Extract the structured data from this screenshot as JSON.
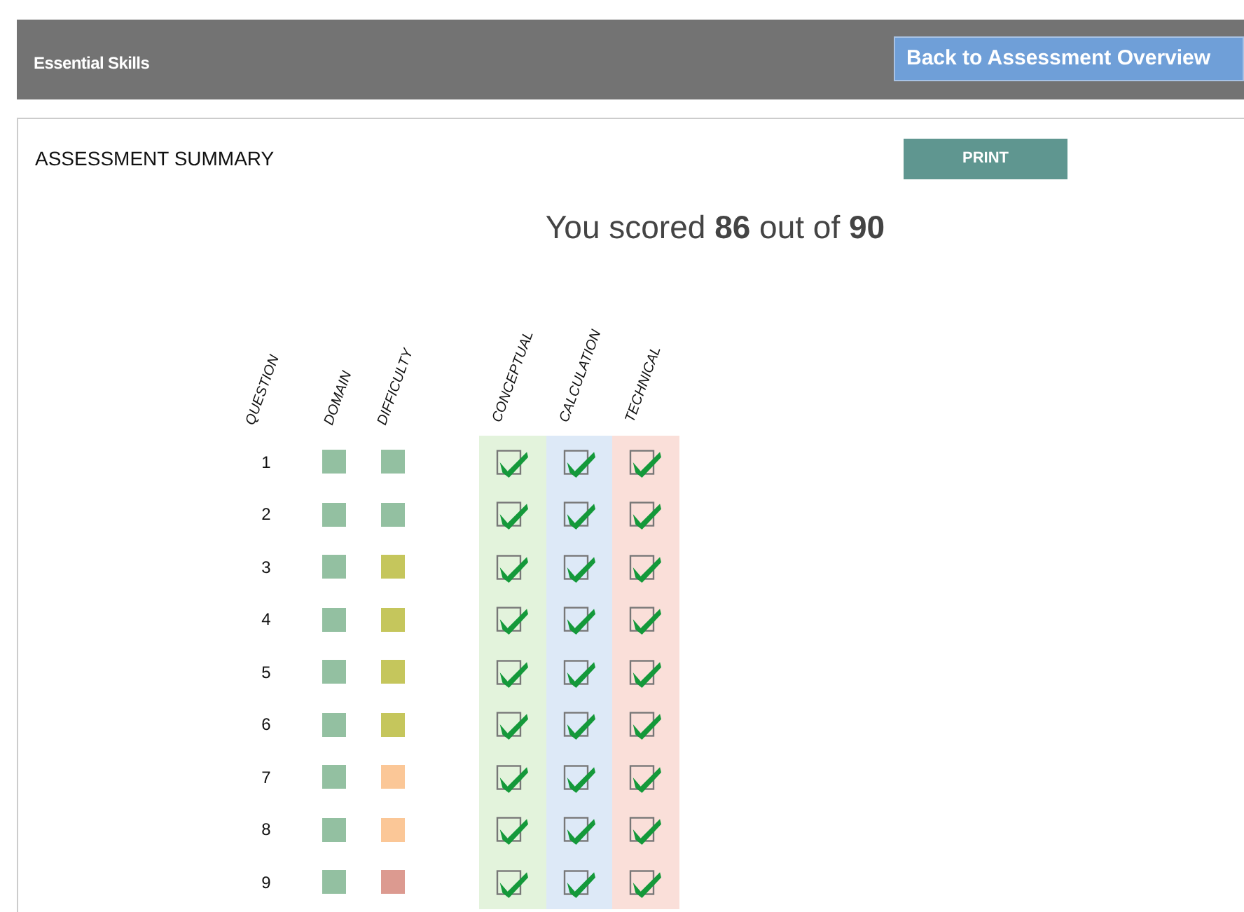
{
  "header": {
    "title": "Essential Skills",
    "back_button": "Back to Assessment Overview"
  },
  "summary": {
    "title": "ASSESSMENT SUMMARY",
    "print_button": "PRINT",
    "score": "You scored **86** out of **90**"
  },
  "table": {
    "columns": [
      {
        "label": "QUESTION"
      },
      {
        "label": "DOMAIN"
      },
      {
        "label": "DIFFICULTY"
      }
    ],
    "score_columns": [
      {
        "label": "CONCEPTUAL",
        "color": "#e3f3dc"
      },
      {
        "label": "CALCULATION",
        "color": "#dde9f7"
      },
      {
        "label": "TECHNICAL",
        "color": "#fadfd9"
      }
    ],
    "rows": [
      {
        "question": "1",
        "domain": {
          "color": "#93c0a1"
        },
        "difficulty": {
          "color": "#93c0a1"
        },
        "checks": [
          true,
          true,
          true
        ]
      },
      {
        "question": "2",
        "domain": {
          "color": "#93c0a1"
        },
        "difficulty": {
          "color": "#93c0a1"
        },
        "checks": [
          true,
          true,
          true
        ]
      },
      {
        "question": "3",
        "domain": {
          "color": "#93c0a1"
        },
        "difficulty": {
          "color": "#c5c65c"
        },
        "checks": [
          true,
          true,
          true
        ]
      },
      {
        "question": "4",
        "domain": {
          "color": "#93c0a1"
        },
        "difficulty": {
          "color": "#c5c65c"
        },
        "checks": [
          true,
          true,
          true
        ]
      },
      {
        "question": "5",
        "domain": {
          "color": "#93c0a1"
        },
        "difficulty": {
          "color": "#c5c65c"
        },
        "checks": [
          true,
          true,
          true
        ]
      },
      {
        "question": "6",
        "domain": {
          "color": "#93c0a1"
        },
        "difficulty": {
          "color": "#c5c65c"
        },
        "checks": [
          true,
          true,
          true
        ]
      },
      {
        "question": "7",
        "domain": {
          "color": "#93c0a1"
        },
        "difficulty": {
          "color": "#fbc797"
        },
        "checks": [
          true,
          true,
          true
        ]
      },
      {
        "question": "8",
        "domain": {
          "color": "#93c0a1"
        },
        "difficulty": {
          "color": "#fbc797"
        },
        "checks": [
          true,
          true,
          true
        ]
      },
      {
        "question": "9",
        "domain": {
          "color": "#93c0a1"
        },
        "difficulty": {
          "color": "#dc9a90"
        },
        "checks": [
          true,
          true,
          true
        ]
      }
    ]
  }
}
